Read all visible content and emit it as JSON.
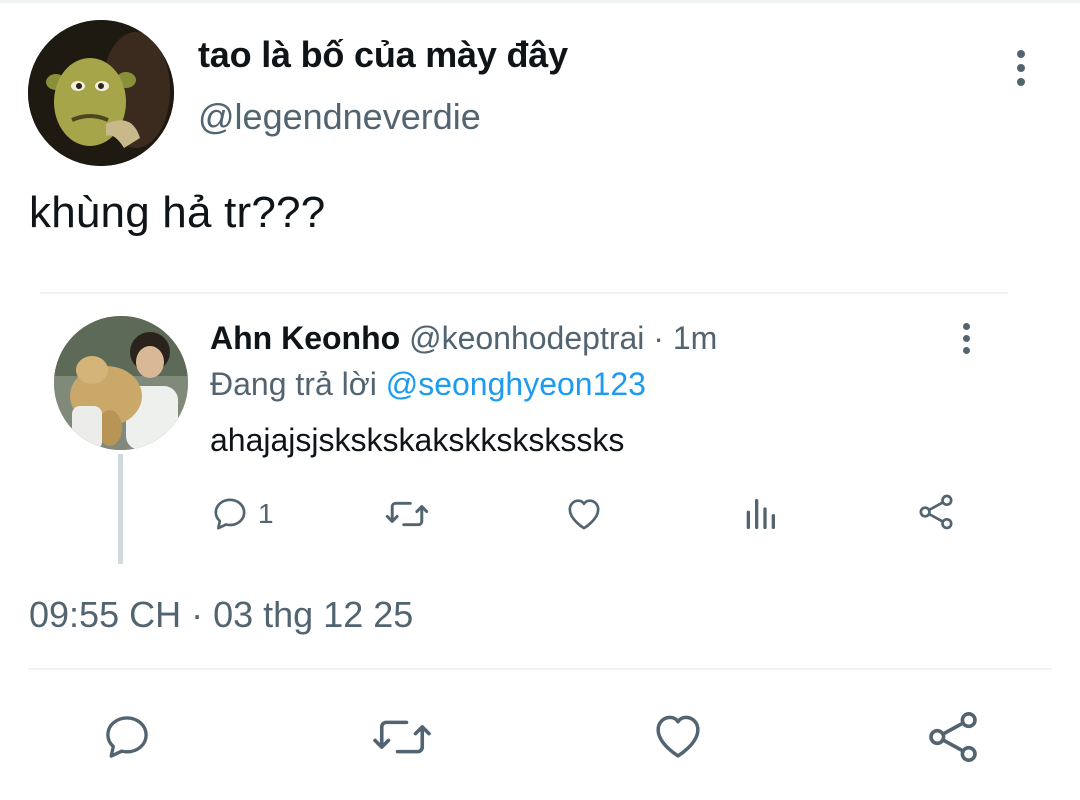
{
  "tweet": {
    "author": {
      "display_name": "tao là bố của mày đây",
      "handle": "@legendneverdie",
      "avatar": "avatar-image"
    },
    "text": "khùng hả tr???",
    "timestamp": "09:55 CH · 03 thg 12 25",
    "more_icon": "more-vertical-icon",
    "actions": {
      "reply_icon": "reply-icon",
      "retweet_icon": "retweet-icon",
      "like_icon": "like-icon",
      "share_icon": "share-icon"
    }
  },
  "quoted_reply": {
    "author": {
      "display_name": "Ahn Keonho",
      "handle": "@keonhodeptrai",
      "time": "· 1m",
      "avatar": "avatar-image"
    },
    "replying_to_label": "Đang trả lời",
    "replying_to_handle": "@seonghyeon123",
    "text": "ahajajsjskskskakskkskskssks",
    "reply_count": "1",
    "more_icon": "more-vertical-icon",
    "actions": {
      "reply_icon": "reply-icon",
      "retweet_icon": "retweet-icon",
      "like_icon": "like-icon",
      "views_icon": "views-icon",
      "share_icon": "share-icon"
    }
  },
  "colors": {
    "text_primary": "#0f1419",
    "text_secondary": "#536471",
    "link": "#1d9bf0",
    "divider": "#eff3f4",
    "thread_line": "#cfd9de"
  }
}
